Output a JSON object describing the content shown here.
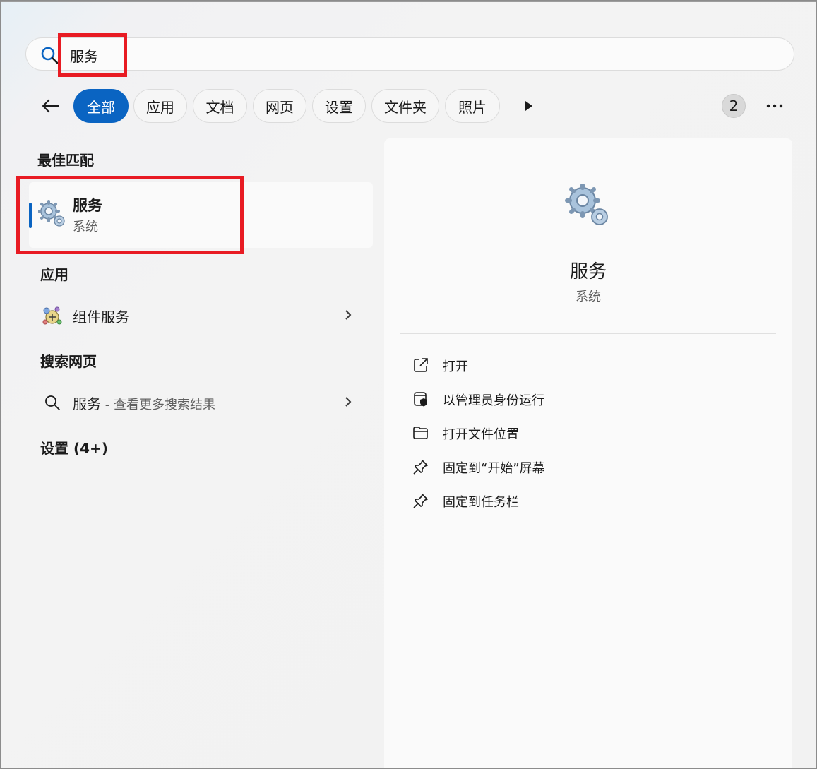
{
  "search": {
    "query": "服务"
  },
  "filters": {
    "tabs": [
      {
        "label": "全部",
        "active": true
      },
      {
        "label": "应用"
      },
      {
        "label": "文档"
      },
      {
        "label": "网页"
      },
      {
        "label": "设置"
      },
      {
        "label": "文件夹"
      },
      {
        "label": "照片"
      }
    ],
    "badge": "2",
    "accent_color": "#0a64c2"
  },
  "left": {
    "best_match_heading": "最佳匹配",
    "best_match": {
      "title": "服务",
      "subtitle": "系统",
      "icon": "gears-icon"
    },
    "apps_heading": "应用",
    "apps": [
      {
        "label": "组件服务",
        "icon": "component-services-icon"
      }
    ],
    "web_heading": "搜索网页",
    "web": {
      "label": "服务",
      "suffix": " - 查看更多搜索结果",
      "icon": "search-icon"
    },
    "settings_heading": "设置 (4+)"
  },
  "detail": {
    "title": "服务",
    "subtitle": "系统",
    "actions": [
      {
        "label": "打开",
        "icon": "open-external-icon"
      },
      {
        "label": "以管理员身份运行",
        "icon": "shield-icon"
      },
      {
        "label": "打开文件位置",
        "icon": "folder-icon"
      },
      {
        "label": "固定到“开始”屏幕",
        "icon": "pin-icon"
      },
      {
        "label": "固定到任务栏",
        "icon": "pin-icon"
      }
    ]
  },
  "highlight_color": "#e81b23"
}
